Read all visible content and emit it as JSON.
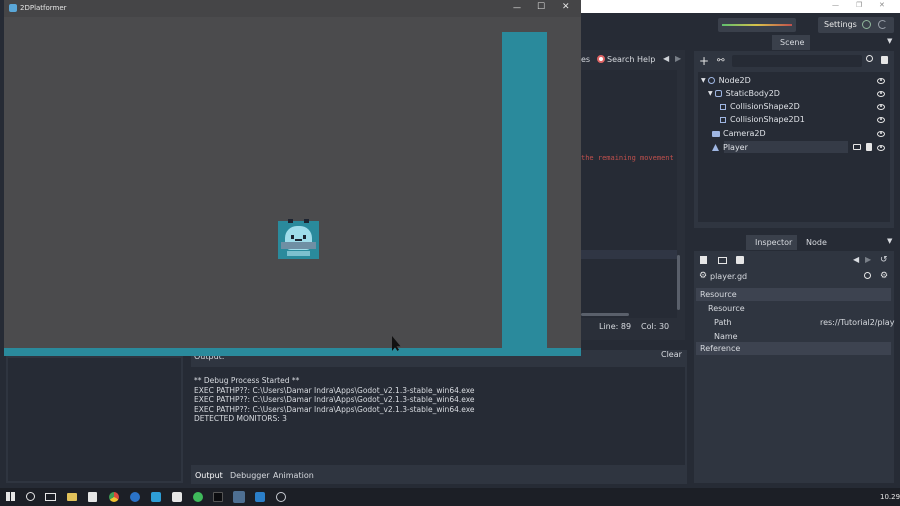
{
  "game_window": {
    "title": "2DPlatformer",
    "controls": {
      "minimize": "—",
      "maximize": "☐",
      "close": "✕"
    }
  },
  "editor_topbar": {
    "settings_label": "Settings",
    "os_controls": {
      "minimize": "—",
      "restore": "❐",
      "close": "✕"
    }
  },
  "script_toolbar": {
    "tab_fragment": "es",
    "search_help_label": "Search Help"
  },
  "code_fragment": "the remaining movement",
  "status": {
    "line": "Line: 89",
    "col": "Col: 30"
  },
  "scene_dock": {
    "tab": "Scene",
    "nodes": [
      {
        "label": "Node2D"
      },
      {
        "label": "StaticBody2D"
      },
      {
        "label": "CollisionShape2D"
      },
      {
        "label": "CollisionShape2D1"
      },
      {
        "label": "Camera2D"
      },
      {
        "label": "Player"
      }
    ]
  },
  "inspector_dock": {
    "tabs": [
      "Inspector",
      "Node"
    ],
    "file": "player.gd",
    "sections": {
      "resource_header": "Resource",
      "resource_sub": "Resource",
      "path_label": "Path",
      "path_value": "res://Tutorial2/play",
      "name_label": "Name",
      "reference": "Reference"
    }
  },
  "output_panel": {
    "title": "Output:",
    "clear_label": "Clear",
    "log": [
      "** Debug Process Started **",
      "EXEC PATHP??: C:\\Users\\Damar Indra\\Apps\\Godot_v2.1.3-stable_win64.exe",
      "EXEC PATHP??: C:\\Users\\Damar Indra\\Apps\\Godot_v2.1.3-stable_win64.exe",
      "EXEC PATHP??: C:\\Users\\Damar Indra\\Apps\\Godot_v2.1.3-stable_win64.exe",
      "DETECTED MONITORS: 3"
    ],
    "tabs": [
      "Output",
      "Debugger",
      "Animation"
    ]
  },
  "taskbar": {
    "clock": "10.29"
  },
  "colors": {
    "game_bg": "#4b4b4d",
    "wall": "#2a8a9c",
    "editor_bg": "#262b35",
    "panel": "#2f3540",
    "accent_red": "#c0504d"
  }
}
